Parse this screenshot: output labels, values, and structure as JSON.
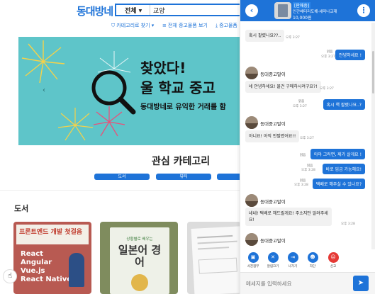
{
  "header": {
    "logo": "동대방네",
    "search_category": "전체",
    "search_value": "교양"
  },
  "subnav": {
    "items": [
      {
        "icon": "⛉",
        "label": "카테고리로 찾기 ▾"
      },
      {
        "icon": "≡",
        "label": "전체 중고물품 보기"
      },
      {
        "icon": "⤓",
        "label": "중고물품"
      }
    ]
  },
  "banner": {
    "line1": "찾았다!",
    "line2": "울 학교 중고",
    "line3": "동대방네로 유익한 거래를 함"
  },
  "section_interest": {
    "title": "관심 카테고리",
    "pills": [
      "도서",
      "뷰티",
      ""
    ]
  },
  "section_books": {
    "title": "도서",
    "books": [
      {
        "cover_title": "프론트엔드 개발 첫걸음",
        "lines": [
          "React",
          "Angular",
          "Vue.js",
          "React Native"
        ]
      },
      {
        "cover_title": "일본어 경어",
        "lines": [
          "상황별로 배우는"
        ]
      },
      {
        "cover_title": "",
        "lines": []
      }
    ]
  },
  "chat": {
    "product": {
      "badge": "[판매중]",
      "name": "인간배터리도해·세미나교재",
      "price": "10,000원"
    },
    "sender_name": "동대중고말이",
    "messages": [
      {
        "dir": "in",
        "text": "혹시 팔렸나요??..",
        "time": "오후 3:27"
      },
      {
        "dir": "out",
        "text": "안녕하세요 !",
        "time": "오후 3:27",
        "read": "읽음"
      },
      {
        "dir": "in",
        "sender": true,
        "text": "네 안녕하세요! 물건 구매하시려구요?!",
        "time": "오후 3:27"
      },
      {
        "dir": "out",
        "text": "혹시 책 팔렸나요..?",
        "time": "오후 3:27",
        "read": "읽음"
      },
      {
        "dir": "in",
        "sender": true,
        "text": "아니요! 아직 안팔렸어요!!",
        "time": "오후 3:27"
      },
      {
        "dir": "out",
        "text": "아아 그러면, 제가 살게요 !",
        "time": "",
        "read": "읽음"
      },
      {
        "dir": "out",
        "text": "바로 입금 가능해요!",
        "time": "오후 3:28",
        "read": "읽음"
      },
      {
        "dir": "out",
        "text": "택배로 해주실 수 있나요?",
        "time": "오후 3:28",
        "read": "읽음"
      },
      {
        "dir": "in",
        "sender": true,
        "text_lines": [
          "네네! 택배로 해드릴게요! 주소지만 알려주세",
          "요!"
        ],
        "time": "오후 3:28"
      },
      {
        "dir": "in",
        "sender": true,
        "text": "",
        "time": ""
      }
    ],
    "actions": [
      {
        "icon": "▣",
        "label": "사진첨부",
        "color": "blue"
      },
      {
        "icon": "✕",
        "label": "알림끄기",
        "color": "blue"
      },
      {
        "icon": "⇥",
        "label": "나가기",
        "color": "blue"
      },
      {
        "icon": "☻",
        "label": "차단",
        "color": "blue"
      },
      {
        "icon": "☹",
        "label": "신고",
        "color": "red"
      }
    ],
    "input_placeholder": "메세지를 입력하세요",
    "send_icon": "➤"
  },
  "colors": {
    "brand": "#1e73d8",
    "banner_bg": "#5ec5c9",
    "report": "#e53935"
  }
}
